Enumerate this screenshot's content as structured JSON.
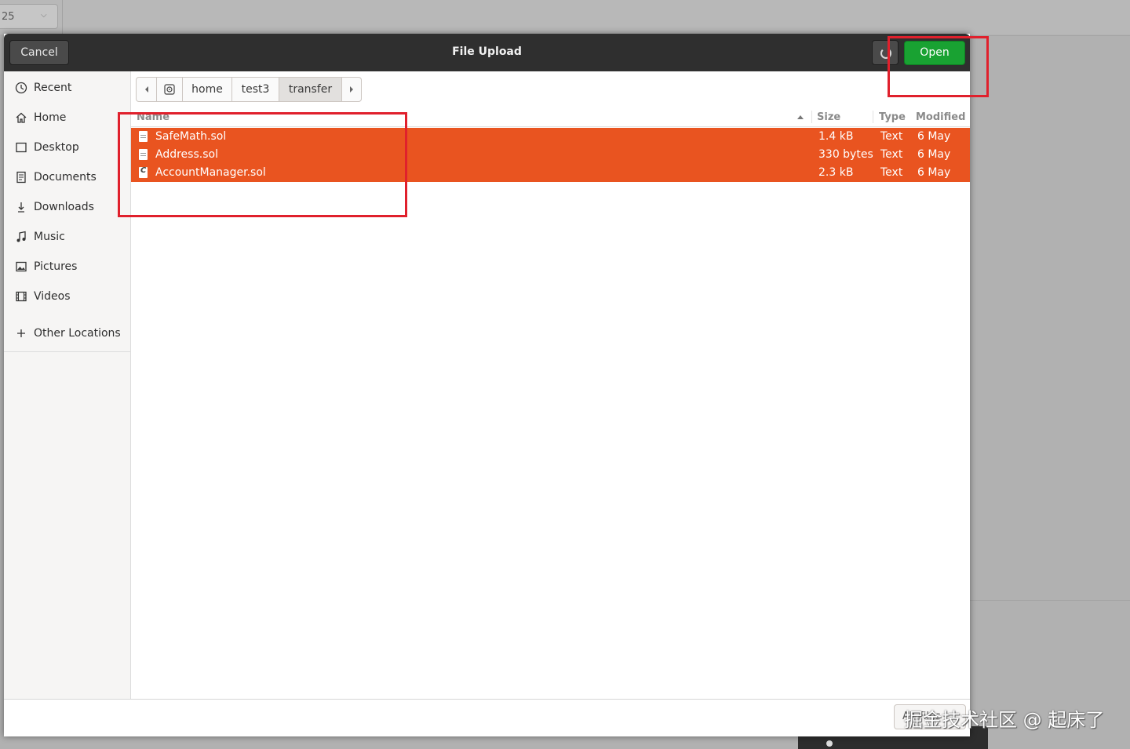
{
  "background": {
    "zoom_value": "25",
    "zoom_chevron": "⌄"
  },
  "dialog": {
    "title": "File Upload",
    "cancel_label": "Cancel",
    "open_label": "Open",
    "accent_open": "#19a232",
    "accent_selection": "#e95420"
  },
  "sidebar": {
    "items": [
      {
        "label": "Recent",
        "icon": "clock-icon"
      },
      {
        "label": "Home",
        "icon": "home-icon"
      },
      {
        "label": "Desktop",
        "icon": "desktop-icon"
      },
      {
        "label": "Documents",
        "icon": "document-icon"
      },
      {
        "label": "Downloads",
        "icon": "download-icon"
      },
      {
        "label": "Music",
        "icon": "music-icon"
      },
      {
        "label": "Pictures",
        "icon": "picture-icon"
      },
      {
        "label": "Videos",
        "icon": "video-icon"
      }
    ],
    "other_locations": "Other Locations"
  },
  "pathbar": {
    "segments": [
      "home",
      "test3",
      "transfer"
    ],
    "active": "transfer"
  },
  "list": {
    "headers": {
      "name": "Name",
      "size": "Size",
      "type": "Type",
      "modified": "Modified"
    },
    "rows": [
      {
        "name": "SafeMath.sol",
        "size": "1.4 kB",
        "type": "Text",
        "modified": "6 May",
        "icon": "text-file-icon"
      },
      {
        "name": "Address.sol",
        "size": "330 bytes",
        "type": "Text",
        "modified": "6 May",
        "icon": "text-file-icon"
      },
      {
        "name": "AccountManager.sol",
        "size": "2.3 kB",
        "type": "Text",
        "modified": "6 May",
        "icon": "c-file-icon"
      }
    ]
  },
  "bottom": {
    "filter_label": "All Files"
  },
  "watermark": "掘金技术社区 @ 起床了"
}
